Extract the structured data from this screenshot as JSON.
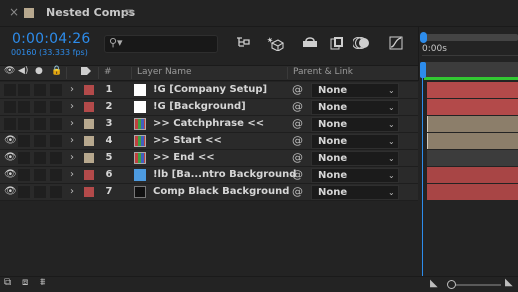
{
  "tab": {
    "close": "×",
    "title": "Nested Comps",
    "menu": "≡",
    "swatch_color": "#b7a88e"
  },
  "timecode": "0:00:04:26",
  "framecount": "00160 (33.333 fps)",
  "search": {
    "placeholder": ""
  },
  "ruler": {
    "start_label": "0:00s"
  },
  "header": {
    "num": "#",
    "layer_name": "Layer Name",
    "parent_link": "Parent & Link"
  },
  "layers": [
    {
      "num": "1",
      "name": "!G [Company Setup]",
      "label_color": "#b34a4a",
      "thumb": "white",
      "parent": "None",
      "visible": false,
      "bar_color": "#b34a4a"
    },
    {
      "num": "2",
      "name": "!G [Background]",
      "label_color": "#b34a4a",
      "thumb": "white",
      "parent": "None",
      "visible": false,
      "bar_color": "#b34a4a"
    },
    {
      "num": "3",
      "name": ">> Catchphrase <<",
      "label_color": "#b7a88e",
      "thumb": "comp",
      "parent": "None",
      "visible": false,
      "bar_color": "#8c7e6a"
    },
    {
      "num": "4",
      "name": ">> Start <<",
      "label_color": "#b7a88e",
      "thumb": "comp",
      "parent": "None",
      "visible": true,
      "bar_color": "#8c7e6a"
    },
    {
      "num": "5",
      "name": ">> End <<",
      "label_color": "#b7a88e",
      "thumb": "comp",
      "parent": "None",
      "visible": true,
      "bar_color": "#3c3c3c"
    },
    {
      "num": "6",
      "name": "!lb [Ba...ntro Background",
      "label_color": "#b34a4a",
      "thumb": "blue",
      "parent": "None",
      "visible": true,
      "bar_color": "#a84545"
    },
    {
      "num": "7",
      "name": "Comp Black Background",
      "label_color": "#b34a4a",
      "thumb": "black",
      "parent": "None",
      "visible": true,
      "bar_color": "#a84545"
    }
  ],
  "colors": {
    "accent": "#2d8ceb",
    "work_area": "#32c832"
  }
}
